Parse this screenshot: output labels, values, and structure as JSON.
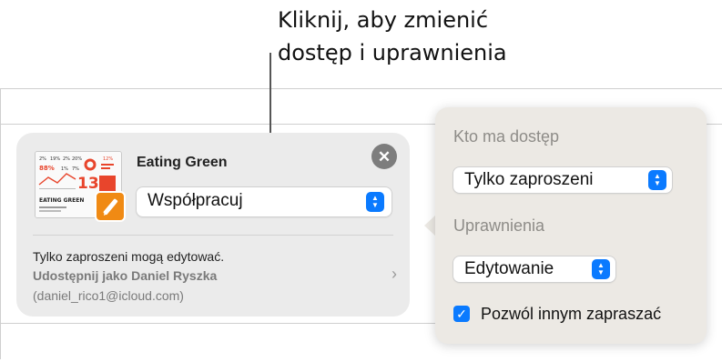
{
  "callout": {
    "line1": "Kliknij, aby zmienić",
    "line2": "dostęp i uprawnienia"
  },
  "share_card": {
    "doc_title": "Eating Green",
    "thumbnail_text": {
      "heading": "EATING GREEN",
      "numbers": [
        "2%",
        "19%",
        "2%",
        "20%",
        "12%",
        "88%",
        "1%",
        "7%",
        "13"
      ]
    },
    "close_label": "✕",
    "role_select": {
      "value": "Współpracuj"
    },
    "info_access": "Tylko zaproszeni mogą edytować.",
    "info_share_as": "Udostępnij jako Daniel Ryszka",
    "info_email": "(daniel_rico1@icloud.com)",
    "chevron": "›"
  },
  "popover": {
    "access_heading": "Kto ma dostęp",
    "access_select": {
      "value": "Tylko zaproszeni"
    },
    "permissions_heading": "Uprawnienia",
    "permissions_select": {
      "value": "Edytowanie"
    },
    "allow_invite": {
      "label": "Pozwól innym zapraszać",
      "checked": true,
      "check_glyph": "✓"
    }
  },
  "colors": {
    "accent": "#0a7aff",
    "pages_badge": "#f08a14",
    "thumb_red": "#e8452c"
  }
}
